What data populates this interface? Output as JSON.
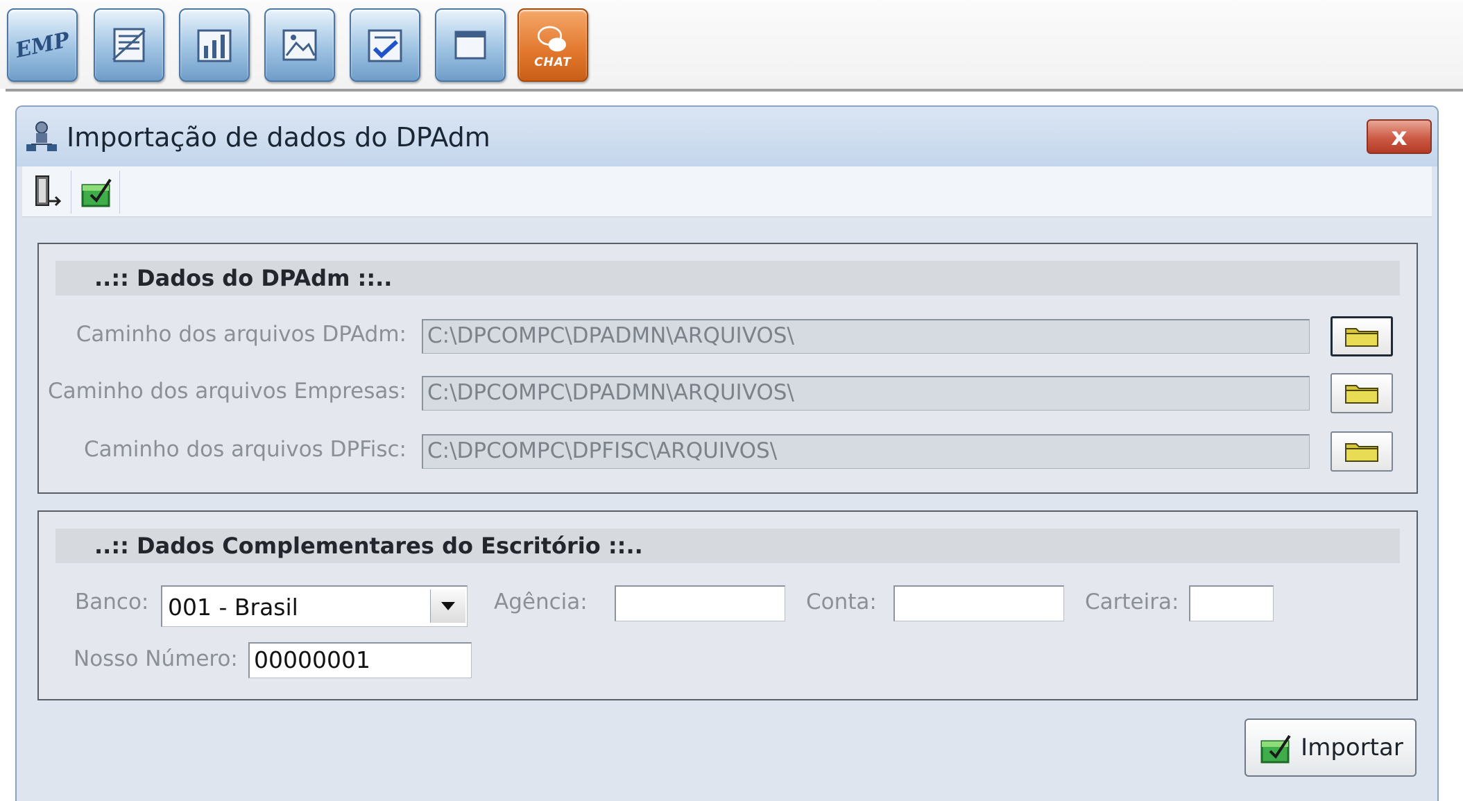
{
  "toolbar": {
    "buttons": [
      {
        "id": "emp",
        "label": "EMP",
        "icon": "emp-icon"
      },
      {
        "id": "doc",
        "icon": "document-icon"
      },
      {
        "id": "chart",
        "icon": "chart-icon"
      },
      {
        "id": "image",
        "icon": "picture-icon"
      },
      {
        "id": "check",
        "icon": "checklist-icon"
      },
      {
        "id": "window",
        "icon": "window-icon"
      },
      {
        "id": "chat",
        "label": "CHAT",
        "icon": "chat-icon"
      }
    ]
  },
  "window": {
    "title": "Importação de dados do DPAdm",
    "close_label": "x"
  },
  "panel_dpadm": {
    "header": "..:: Dados do DPAdm ::..",
    "fields": [
      {
        "label": "Caminho dos arquivos DPAdm:",
        "value": "C:\\DPCOMPC\\DPADMN\\ARQUIVOS\\"
      },
      {
        "label": "Caminho dos arquivos Empresas:",
        "value": "C:\\DPCOMPC\\DPADMN\\ARQUIVOS\\"
      },
      {
        "label": "Caminho dos arquivos DPFisc:",
        "value": "C:\\DPCOMPC\\DPFISC\\ARQUIVOS\\"
      }
    ]
  },
  "panel_escritorio": {
    "header": "..:: Dados Complementares do Escritório ::..",
    "banco_label": "Banco:",
    "banco_value": "001 - Brasil",
    "agencia_label": "Agência:",
    "agencia_value": "",
    "conta_label": "Conta:",
    "conta_value": "",
    "carteira_label": "Carteira:",
    "carteira_value": "",
    "nosso_numero_label": "Nosso Número:",
    "nosso_numero_value": "00000001"
  },
  "actions": {
    "import_label": "Importar"
  }
}
